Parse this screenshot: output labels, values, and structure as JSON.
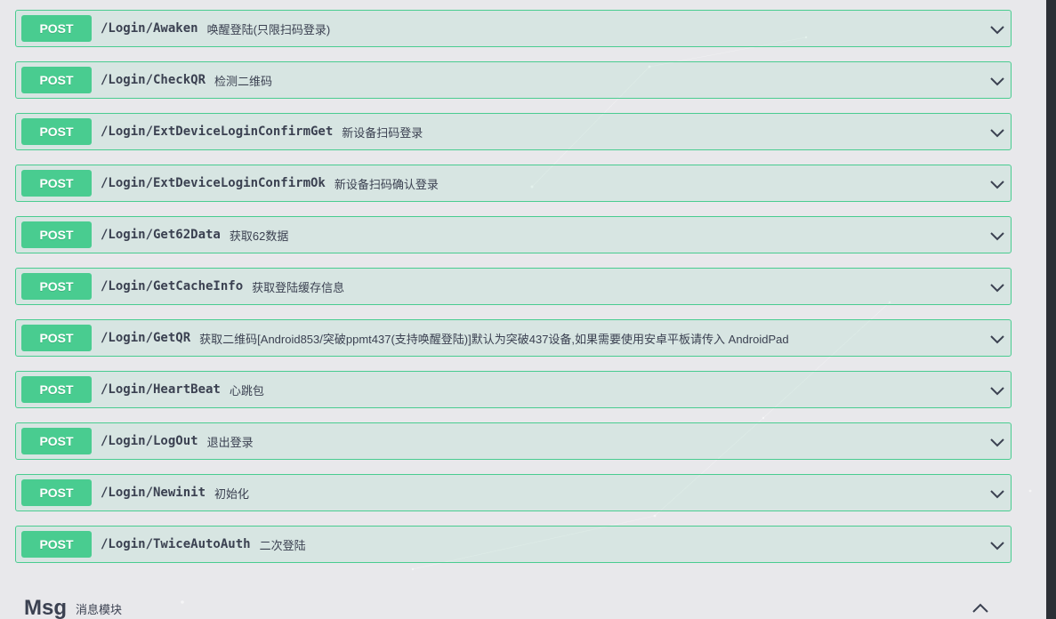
{
  "operations": [
    {
      "method": "POST",
      "path": "/Login/Awaken",
      "summary": "唤醒登陆(只限扫码登录)"
    },
    {
      "method": "POST",
      "path": "/Login/CheckQR",
      "summary": "检测二维码"
    },
    {
      "method": "POST",
      "path": "/Login/ExtDeviceLoginConfirmGet",
      "summary": "新设备扫码登录"
    },
    {
      "method": "POST",
      "path": "/Login/ExtDeviceLoginConfirmOk",
      "summary": "新设备扫码确认登录"
    },
    {
      "method": "POST",
      "path": "/Login/Get62Data",
      "summary": "获取62数据"
    },
    {
      "method": "POST",
      "path": "/Login/GetCacheInfo",
      "summary": "获取登陆缓存信息"
    },
    {
      "method": "POST",
      "path": "/Login/GetQR",
      "summary": "获取二维码[Android853/突破ppmt437(支持唤醒登陆)]默认为突破437设备,如果需要使用安卓平板请传入 AndroidPad"
    },
    {
      "method": "POST",
      "path": "/Login/HeartBeat",
      "summary": "心跳包"
    },
    {
      "method": "POST",
      "path": "/Login/LogOut",
      "summary": "退出登录"
    },
    {
      "method": "POST",
      "path": "/Login/Newinit",
      "summary": "初始化"
    },
    {
      "method": "POST",
      "path": "/Login/TwiceAutoAuth",
      "summary": "二次登陆"
    }
  ],
  "next_section": {
    "name": "Msg",
    "description": "消息模块"
  },
  "colors": {
    "post": "#49cc90",
    "text": "#3b4151",
    "background": "#e8e8eb"
  },
  "icons": {
    "op_toggle": "chevron-down-icon",
    "section_toggle": "chevron-up-icon"
  }
}
